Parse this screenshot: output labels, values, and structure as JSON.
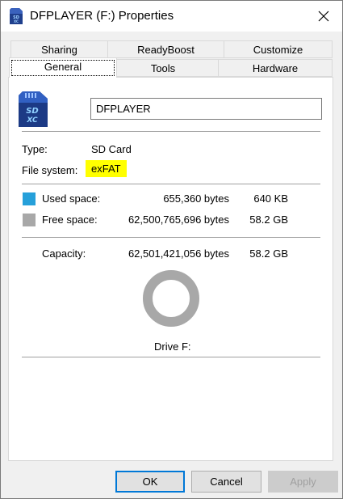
{
  "window": {
    "title": "DFPLAYER (F:) Properties"
  },
  "tabs": {
    "row_top": [
      {
        "label": "Sharing"
      },
      {
        "label": "ReadyBoost"
      },
      {
        "label": "Customize"
      }
    ],
    "row_bottom": [
      {
        "label": "General",
        "active": true
      },
      {
        "label": "Tools"
      },
      {
        "label": "Hardware"
      }
    ]
  },
  "general": {
    "volume_name": "DFPLAYER",
    "type_label": "Type:",
    "type_value": "SD Card",
    "fs_label": "File system:",
    "fs_value": "exFAT",
    "used": {
      "label": "Used space:",
      "bytes": "655,360 bytes",
      "size": "640 KB",
      "color": "#26a0da"
    },
    "free": {
      "label": "Free space:",
      "bytes": "62,500,765,696 bytes",
      "size": "58.2 GB",
      "color": "#a8a8a8"
    },
    "capacity": {
      "label": "Capacity:",
      "bytes": "62,501,421,056 bytes",
      "size": "58.2 GB"
    },
    "used_fraction": 1.05e-05,
    "drive_label": "Drive F:"
  },
  "buttons": {
    "ok": "OK",
    "cancel": "Cancel",
    "apply": "Apply"
  },
  "icons": {
    "title": "sdxc-card-icon",
    "drive": "sdxc-card-icon",
    "close": "close-icon"
  }
}
